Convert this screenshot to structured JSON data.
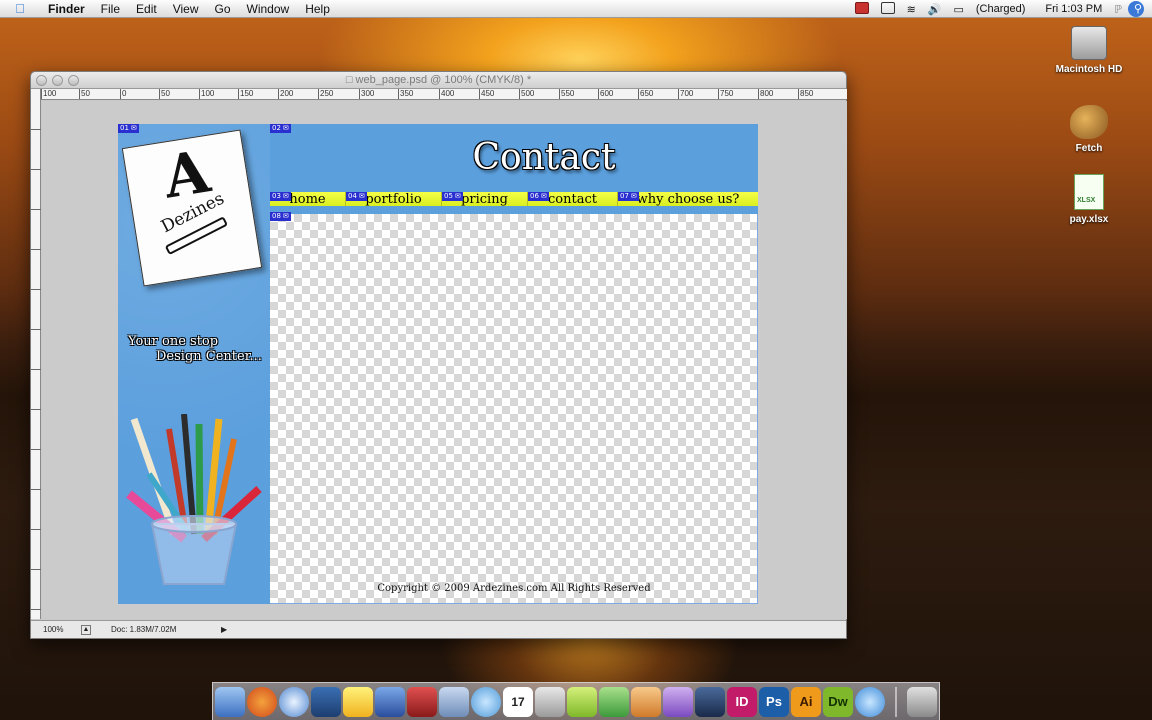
{
  "menubar": {
    "app": "Finder",
    "items": [
      "File",
      "Edit",
      "View",
      "Go",
      "Window",
      "Help"
    ],
    "battery": "(Charged)",
    "clock": "Fri 1:03 PM"
  },
  "desktop": {
    "icons": [
      {
        "label": "Macintosh HD",
        "icon": "hard-drive-icon"
      },
      {
        "label": "Fetch",
        "icon": "fetch-dog-icon"
      },
      {
        "label": "pay.xlsx",
        "icon": "xlsx-file-icon"
      }
    ]
  },
  "photoshop": {
    "title": "web_page.psd @ 100% (CMYK/8) *",
    "ruler_ticks": [
      "100",
      "50",
      "0",
      "50",
      "100",
      "150",
      "200",
      "250",
      "300",
      "350",
      "400",
      "450",
      "500",
      "550",
      "600",
      "650",
      "700",
      "750",
      "800",
      "850"
    ],
    "status": {
      "zoom": "100%",
      "doc": "Doc: 1.83M/7.02M"
    },
    "document": {
      "page_title": "Contact",
      "nav": [
        "home",
        "portfolio",
        "pricing",
        "contact",
        "why choose us?"
      ],
      "slice_tags": [
        "01",
        "02",
        "03",
        "04",
        "05",
        "06",
        "07",
        "08"
      ],
      "logo_letter": "A",
      "logo_brand": "Dezines",
      "tagline_line1": "Your one stop",
      "tagline_line2": "Design Center...",
      "copyright": "Copyright © 2009 Ardezines.com All Rights Reserved",
      "colors": {
        "sidebar_blue": "#5b9fdd",
        "nav_yellow": "#f5ff46",
        "slice_tag": "#2a2fd0"
      }
    }
  },
  "dock": {
    "items": [
      {
        "name": "finder",
        "label": ""
      },
      {
        "name": "firefox",
        "label": ""
      },
      {
        "name": "safari",
        "label": ""
      },
      {
        "name": "direct",
        "label": ""
      },
      {
        "name": "scriptbar",
        "label": ""
      },
      {
        "name": "clapper",
        "label": ""
      },
      {
        "name": "red-app",
        "label": ""
      },
      {
        "name": "preview",
        "label": ""
      },
      {
        "name": "ichat",
        "label": ""
      },
      {
        "name": "calendar",
        "label": "17"
      },
      {
        "name": "apple-app",
        "label": ""
      },
      {
        "name": "lime-app",
        "label": ""
      },
      {
        "name": "green-app",
        "label": ""
      },
      {
        "name": "orange-app",
        "label": ""
      },
      {
        "name": "purple-app",
        "label": ""
      },
      {
        "name": "film-app",
        "label": ""
      },
      {
        "name": "indesign",
        "label": "ID"
      },
      {
        "name": "photoshop",
        "label": "Ps"
      },
      {
        "name": "illustrator",
        "label": "Ai"
      },
      {
        "name": "dreamweaver",
        "label": "Dw"
      },
      {
        "name": "people-app",
        "label": ""
      },
      {
        "name": "trash",
        "label": ""
      }
    ]
  }
}
